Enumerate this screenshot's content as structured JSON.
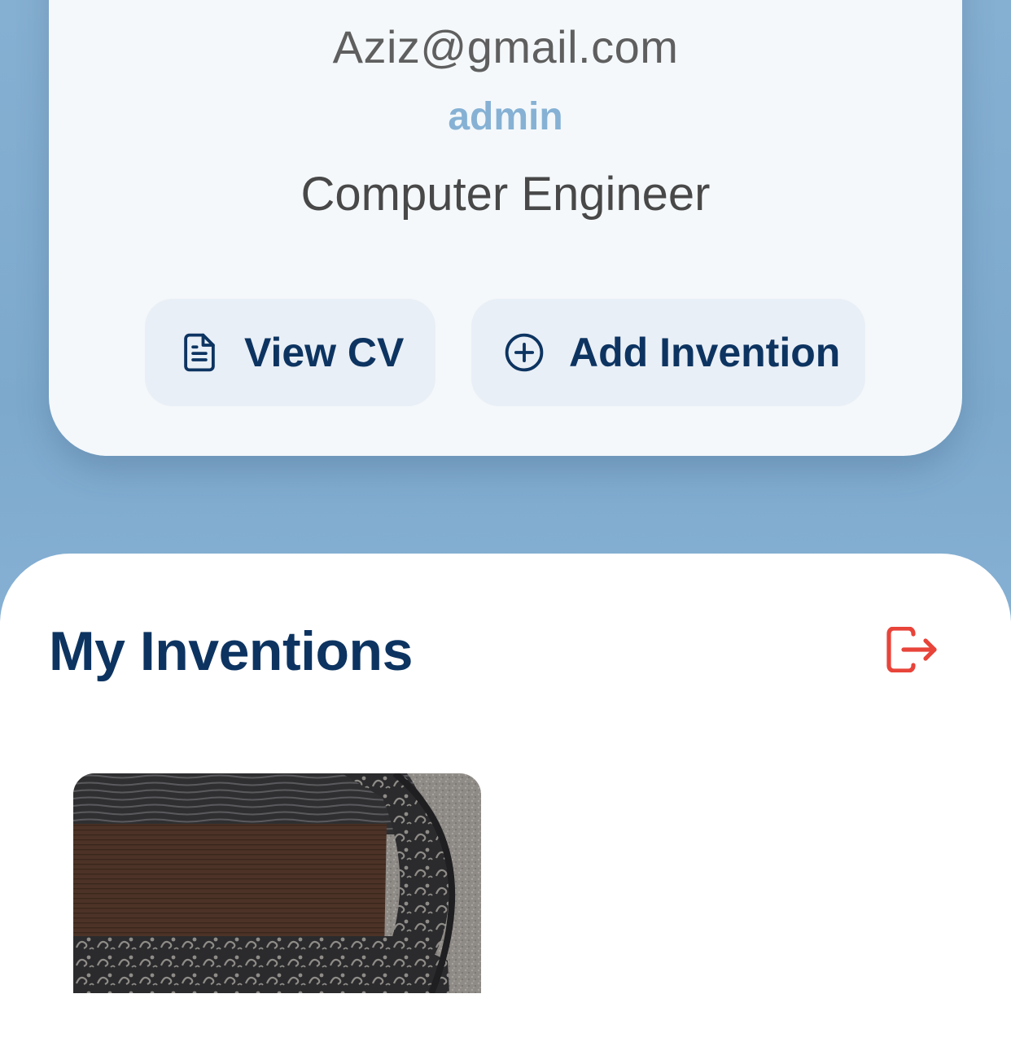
{
  "profile": {
    "email": "Aziz@gmail.com",
    "role": "admin",
    "profession": "Computer Engineer",
    "actions": {
      "view_cv_label": "View CV",
      "add_invention_label": "Add Invention"
    }
  },
  "inventions": {
    "title": "My Inventions",
    "items": [
      {
        "image": "doormat-photo"
      }
    ]
  },
  "icons": {
    "view_cv": "document-icon",
    "add_invention": "plus-circle-icon",
    "logout": "logout-icon"
  },
  "colors": {
    "background": "#84afd3",
    "card": "#f4f8fb",
    "primary_text": "#0d3461",
    "role_accent": "#86b1d4",
    "logout": "#e8443a",
    "button_bg": "#e9eff6"
  }
}
